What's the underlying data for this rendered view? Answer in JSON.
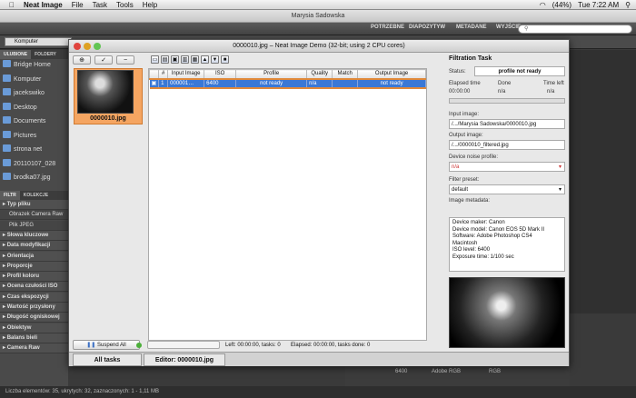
{
  "menubar": {
    "app": "Neat Image",
    "items": [
      "File",
      "Task",
      "Tools",
      "Help"
    ],
    "battery": "(44%)",
    "clock": "Tue 7:22 AM"
  },
  "bridge": {
    "window_title": "Marysia Sadowska",
    "workspaces": [
      "POTRZEBNE",
      "DIAPOZYTYW",
      "METADANE",
      "WYJŚCIE"
    ],
    "search_placeholder": "",
    "path": "Komputer",
    "left_tabs": [
      "ULUBIONE",
      "FOLDERY"
    ],
    "favorites": [
      "Bridge Home",
      "Komputer",
      "jacekswiko",
      "Desktop",
      "Documents",
      "Pictures",
      "strona net",
      "20110107_028",
      "brodka07.jpg"
    ],
    "filter_tabs": [
      "FILTR",
      "KOLEKCJE"
    ],
    "filters": [
      {
        "label": "Typ pliku",
        "sub": false
      },
      {
        "label": "Obrazek Camera Raw",
        "sub": true
      },
      {
        "label": "Plik JPEG",
        "sub": true
      },
      {
        "label": "Słowa kluczowe",
        "sub": false
      },
      {
        "label": "Data modyfikacji",
        "sub": false
      },
      {
        "label": "Orientacja",
        "sub": false
      },
      {
        "label": "Proporcje",
        "sub": false
      },
      {
        "label": "Profil koloru",
        "sub": false
      },
      {
        "label": "Ocena czułości ISO",
        "sub": false
      },
      {
        "label": "Czas ekspozycji",
        "sub": false
      },
      {
        "label": "Wartość przysłony",
        "sub": false
      },
      {
        "label": "Długość ogniskowej",
        "sub": false
      },
      {
        "label": "Obiektyw",
        "sub": false
      },
      {
        "label": "Balans bieli",
        "sub": false
      },
      {
        "label": "Camera Raw",
        "sub": false
      }
    ],
    "status": "Liczba elementów: 35, ukrytych: 32, zaznaczonych: 1 - 1,11 MB",
    "meta_strip": {
      "iso": "6400",
      "profile": "Adobe RGB",
      "space": "RGB"
    }
  },
  "neat": {
    "title": "0000010.jpg – Neat Image Demo (32-bit; using 2 CPU cores)",
    "thumb_label": "0000010.jpg",
    "columns": [
      "",
      "#",
      "Input Image",
      "ISO",
      "Profile",
      "Quality",
      "Match",
      "Output Image"
    ],
    "rows": [
      {
        "num": "1",
        "input": "000001…",
        "iso": "6400",
        "profile": "not ready",
        "quality": "n/a",
        "match": "",
        "output": "not ready"
      }
    ],
    "status_left": "Left: 00:00:00, tasks: 0",
    "status_elapsed": "Elapsed: 00:00:00, tasks done: 0",
    "suspend_label": "Suspend All",
    "tab_all": "All tasks",
    "tab_editor": "Editor: 0000010.jpg",
    "ft": {
      "header": "Filtration Task",
      "status_label": "Status:",
      "status_value": "profile not ready",
      "elapsed_label": "Elapsed time",
      "elapsed_value": "00:00:00",
      "done_label": "Done",
      "done_value": "n/a",
      "timeleft_label": "Time left",
      "timeleft_value": "n/a",
      "input_label": "Input image:",
      "input_value": "/.../Marysia Sadowska/0000010.jpg",
      "output_label": "Output image:",
      "output_value": "/.../0000010_filtered.jpg",
      "noise_label": "Device noise profile:",
      "noise_value": "n/a",
      "preset_label": "Filter preset:",
      "preset_value": "default",
      "meta_label": "Image metadata:",
      "meta_lines": [
        "Device maker: Canon",
        "Device model: Canon EOS 5D Mark II",
        "Software: Adobe Photoshop CS4",
        "Macintosh",
        "ISO level: 6400",
        "Exposure time: 1/100 sec"
      ]
    }
  }
}
